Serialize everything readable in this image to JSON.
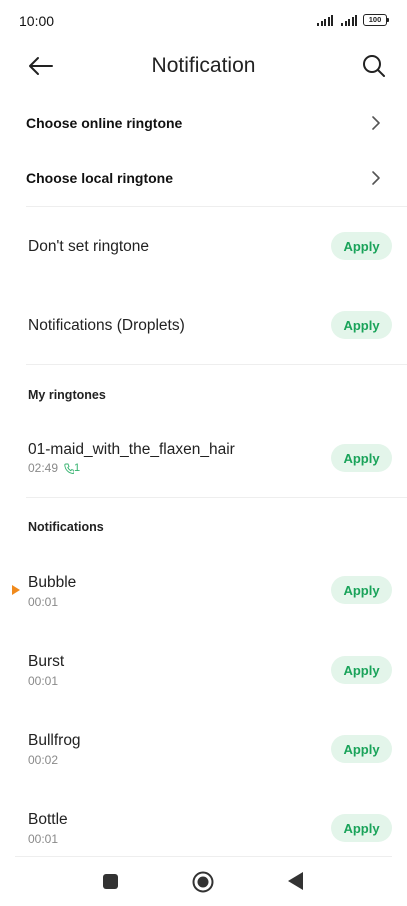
{
  "status_bar": {
    "time": "10:00",
    "battery": "100"
  },
  "header": {
    "title": "Notification",
    "back_icon": "arrow-left-icon",
    "search_icon": "search-icon"
  },
  "nav_links": [
    {
      "label": "Choose online ringtone"
    },
    {
      "label": "Choose local ringtone"
    }
  ],
  "preset_items": [
    {
      "title": "Don't set ringtone",
      "action": "Apply"
    },
    {
      "title": "Notifications (Droplets)",
      "action": "Apply"
    }
  ],
  "sections": {
    "my_ringtones": {
      "title": "My ringtones",
      "items": [
        {
          "title": "01-maid_with_the_flaxen_hair",
          "duration": "02:49",
          "tag": "1",
          "action": "Apply"
        }
      ]
    },
    "notifications": {
      "title": "Notifications",
      "items": [
        {
          "title": "Bubble",
          "duration": "00:01",
          "action": "Apply",
          "playing": true
        },
        {
          "title": "Burst",
          "duration": "00:01",
          "action": "Apply"
        },
        {
          "title": "Bullfrog",
          "duration": "00:02",
          "action": "Apply"
        },
        {
          "title": "Bottle",
          "duration": "00:01",
          "action": "Apply"
        }
      ]
    }
  },
  "colors": {
    "accent": "#1aa35a",
    "accent_bg": "#e3f5ea",
    "playing_marker": "#f08a1c"
  }
}
